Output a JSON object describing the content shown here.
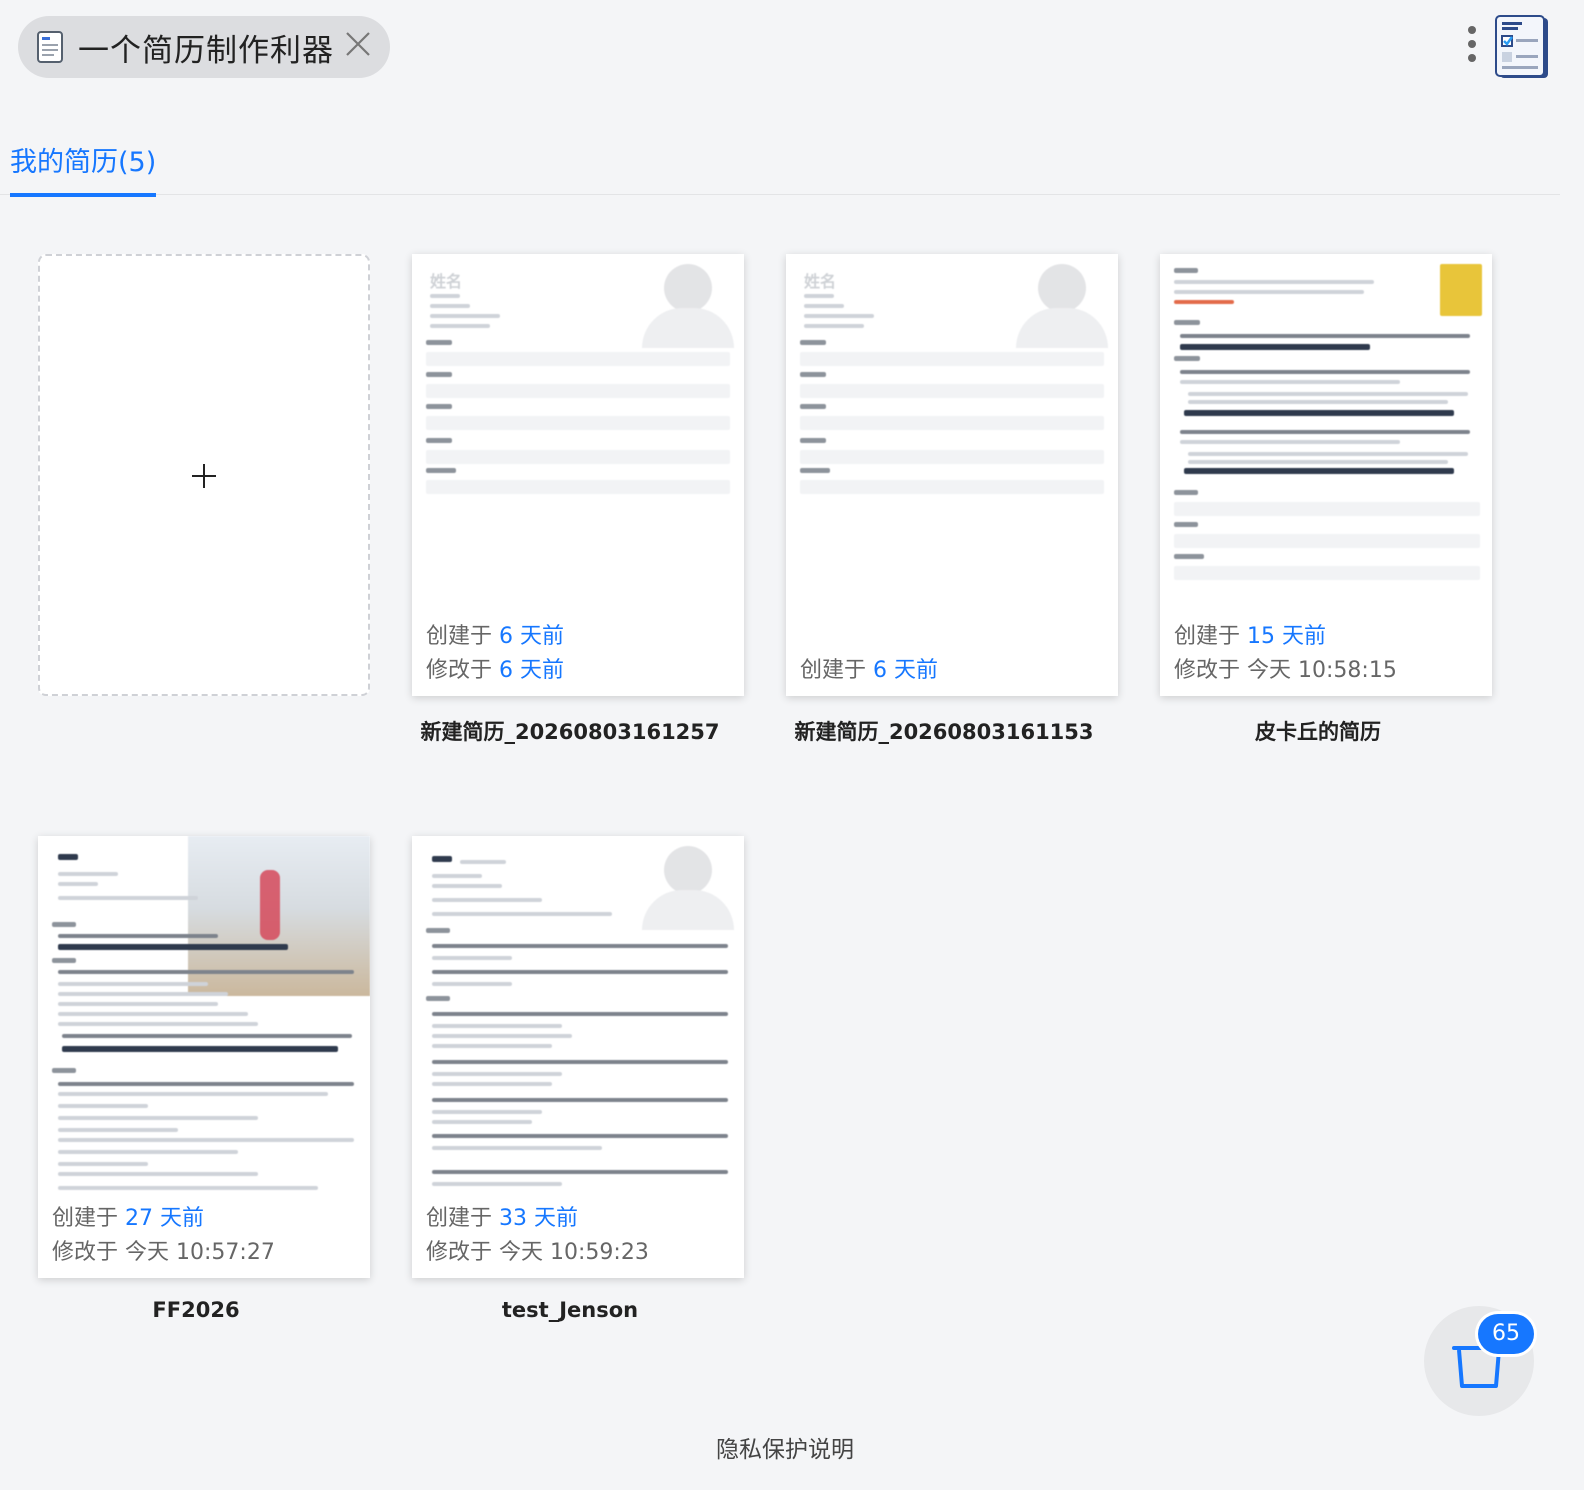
{
  "app": {
    "title": "一个简历制作利器",
    "close_icon": "close-icon",
    "menu_icon": "more-vertical-icon",
    "logo_icon": "resume-editor-logo"
  },
  "tabs": [
    {
      "label": "我的简历(5)",
      "active": true
    }
  ],
  "new_card": {
    "icon": "plus-icon"
  },
  "resumes": [
    {
      "name": "新建简历_20260803161257",
      "created_label": "创建于",
      "created": "6 天前",
      "modified_label": "修改于",
      "modified": "6 天前"
    },
    {
      "name": "新建简历_20260803161153",
      "created_label": "创建于",
      "created": "6 天前"
    },
    {
      "name": "皮卡丘的简历",
      "created_label": "创建于",
      "created": "15 天前",
      "modified_label": "修改于",
      "modified": "今天 10:58:15"
    },
    {
      "name": "FF2026",
      "created_label": "创建于",
      "created": "27 天前",
      "modified_label": "修改于",
      "modified": "今天 10:57:27"
    },
    {
      "name": "test_Jenson",
      "created_label": "创建于",
      "created": "33 天前",
      "modified_label": "修改于",
      "modified": "今天 10:59:23"
    }
  ],
  "preview_text": {
    "name_placeholder": "姓名"
  },
  "trash": {
    "icon": "trash-icon",
    "count": "65"
  },
  "footer": {
    "privacy_link": "隐私保护说明"
  },
  "colors": {
    "accent": "#1677ff",
    "background": "#f4f5f7"
  }
}
